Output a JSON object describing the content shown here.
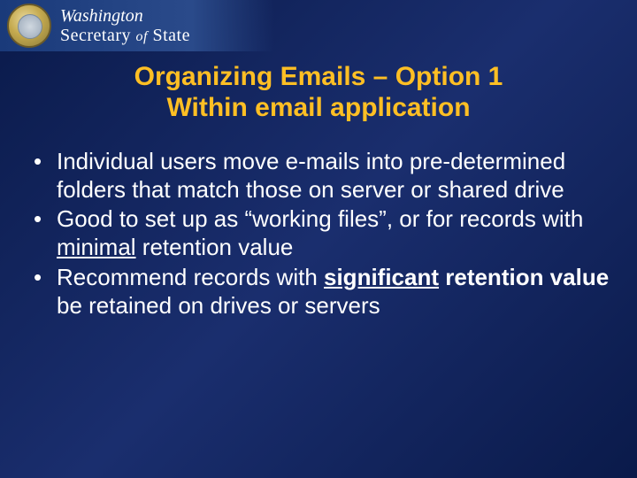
{
  "header": {
    "state": "Washington",
    "office": "Secretary of State"
  },
  "title_line1": "Organizing Emails – Option 1",
  "title_line2": "Within email application",
  "bullets": {
    "b1": "Individual users move e-mails into pre-determined folders that match those on server or shared drive",
    "b2_pre": "Good to set up as “working files”, or for records with ",
    "b2_u": "minimal",
    "b2_post": " retention value",
    "b3_pre": "Recommend records with ",
    "b3_ub": "significant",
    "b3_b": " retention value",
    "b3_post": " be retained on drives or servers"
  }
}
